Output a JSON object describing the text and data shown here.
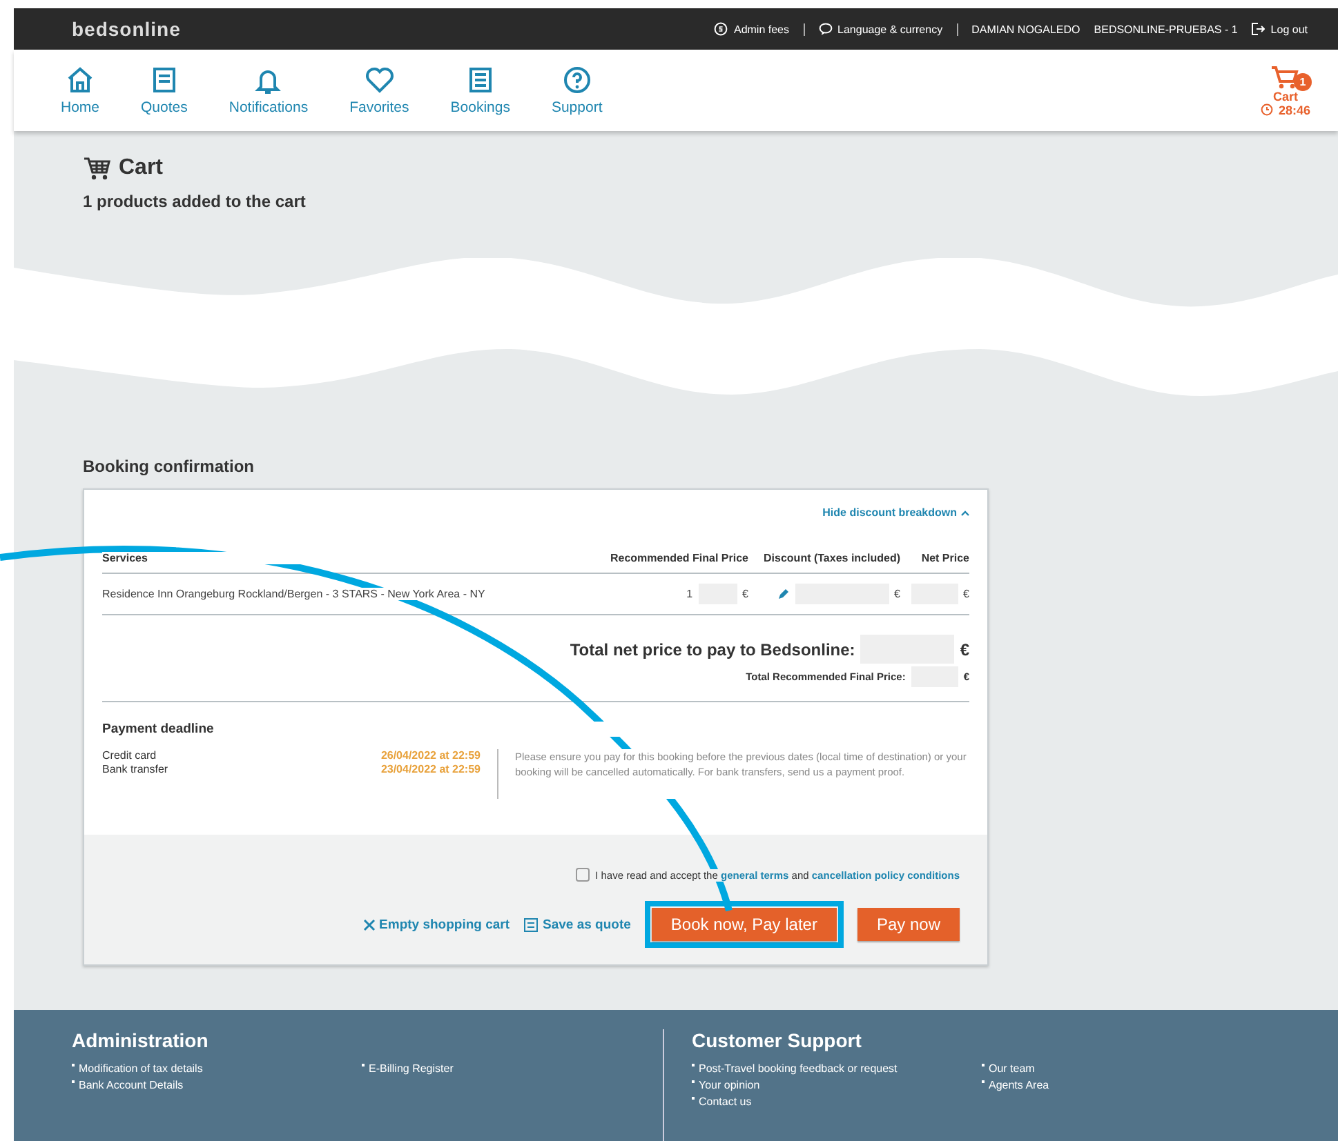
{
  "topbar": {
    "logo": "bedsonline",
    "links": [
      {
        "label": "Admin fees"
      },
      {
        "label": "Language & currency"
      }
    ],
    "user": "DAMIAN NOGALEDO",
    "agency": "BEDSONLINE-PRUEBAS - 1",
    "logout": "Log out"
  },
  "nav": [
    {
      "label": "Home"
    },
    {
      "label": "Quotes"
    },
    {
      "label": "Notifications"
    },
    {
      "label": "Favorites"
    },
    {
      "label": "Bookings"
    },
    {
      "label": "Support"
    }
  ],
  "cart": {
    "label": "Cart",
    "count": "1",
    "timer": "28:46"
  },
  "page": {
    "title": "Cart",
    "subtitle": "1 products added to the cart",
    "section": "Booking confirmation"
  },
  "booking": {
    "toggle": "Hide discount breakdown",
    "columns": [
      "Services",
      "Recommended Final Price",
      "Discount (Taxes included)",
      "Net Price"
    ],
    "rows": [
      {
        "service": "Residence Inn Orangeburg Rockland/Bergen - 3 STARS - New York Area - NY",
        "price_prefix": "1",
        "currency": "€"
      }
    ],
    "total_label": "Total net price to pay to Bedsonline:",
    "total_currency": "€",
    "recommended_label": "Total Recommended Final Price:",
    "recommended_currency": "€",
    "deadline_title": "Payment deadline",
    "deadlines": [
      {
        "method": "Credit card",
        "date": "26/04/2022 at 22:59"
      },
      {
        "method": "Bank transfer",
        "date": "23/04/2022 at 22:59"
      }
    ],
    "notice": "Please ensure you pay for this booking before the previous dates (local time of destination) or your booking will be cancelled automatically. For bank transfers, send us a payment proof.",
    "terms": {
      "checked": false,
      "before": "I have read and accept the",
      "link1": "general terms",
      "middle": "and",
      "link2": "cancellation policy conditions"
    },
    "actions": {
      "empty": "Empty shopping cart",
      "save": "Save as quote",
      "book_later": "Book now, Pay later",
      "pay": "Pay now"
    }
  },
  "footer": [
    {
      "title": "Administration",
      "links": [
        [
          "Modification of tax details",
          "Bank Account Details"
        ],
        [
          "E-Billing Register"
        ]
      ]
    },
    {
      "title": "Customer Support",
      "links": [
        [
          "Post-Travel booking feedback or request",
          "Your opinion",
          "Contact us"
        ],
        [
          "Our team",
          "Agents Area"
        ]
      ]
    }
  ]
}
